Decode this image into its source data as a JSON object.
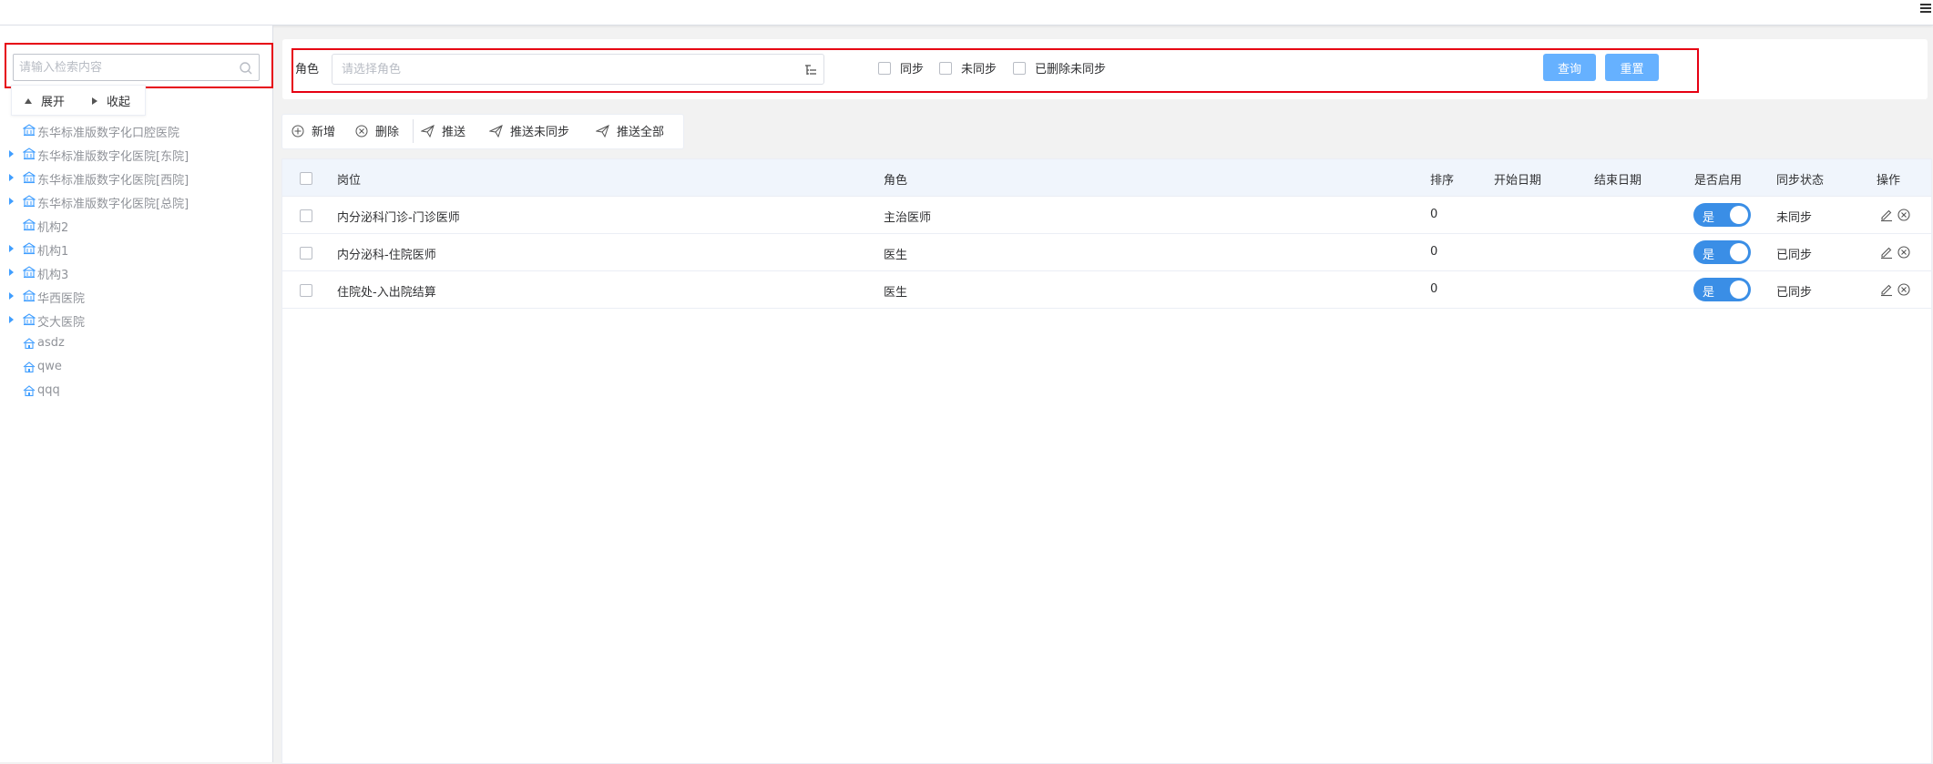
{
  "header": {
    "menu_icon": "hamburger-menu-icon"
  },
  "sidebar": {
    "search_placeholder": "请输入检索内容",
    "expand_label": "展开",
    "collapse_label": "收起",
    "tree": [
      {
        "label": "东华标准版数字化口腔医院",
        "has_children": false,
        "icon": "building-icon"
      },
      {
        "label": "东华标准版数字化医院[东院]",
        "has_children": true,
        "icon": "building-icon"
      },
      {
        "label": "东华标准版数字化医院[西院]",
        "has_children": true,
        "icon": "building-icon"
      },
      {
        "label": "东华标准版数字化医院[总院]",
        "has_children": true,
        "icon": "building-icon"
      },
      {
        "label": "机构2",
        "has_children": false,
        "icon": "building-icon"
      },
      {
        "label": "机构1",
        "has_children": true,
        "icon": "building-icon"
      },
      {
        "label": "机构3",
        "has_children": true,
        "icon": "building-icon"
      },
      {
        "label": "华西医院",
        "has_children": true,
        "icon": "building-icon"
      },
      {
        "label": "交大医院",
        "has_children": true,
        "icon": "building-icon"
      },
      {
        "label": "asdz",
        "has_children": false,
        "icon": "house-icon"
      },
      {
        "label": "qwe",
        "has_children": false,
        "icon": "house-icon"
      },
      {
        "label": "qqq",
        "has_children": false,
        "icon": "house-icon"
      }
    ]
  },
  "filter": {
    "role_label": "角色",
    "role_placeholder": "请选择角色",
    "checkboxes": [
      "同步",
      "未同步",
      "已删除未同步"
    ],
    "query_label": "查询",
    "reset_label": "重置"
  },
  "toolbar": {
    "add_label": "新增",
    "delete_label": "删除",
    "push_label": "推送",
    "push_unsynced_label": "推送未同步",
    "push_all_label": "推送全部"
  },
  "table": {
    "columns": {
      "post": "岗位",
      "role": "角色",
      "order": "排序",
      "start_date": "开始日期",
      "end_date": "结束日期",
      "enabled": "是否启用",
      "sync_status": "同步状态",
      "actions": "操作"
    },
    "rows": [
      {
        "post": "内分泌科门诊-门诊医师",
        "role": "主治医师",
        "order": "0",
        "start_date": "",
        "end_date": "",
        "enabled": "是",
        "sync_status": "未同步"
      },
      {
        "post": "内分泌科-住院医师",
        "role": "医生",
        "order": "0",
        "start_date": "",
        "end_date": "",
        "enabled": "是",
        "sync_status": "已同步"
      },
      {
        "post": "住院处-入出院结算",
        "role": "医生",
        "order": "0",
        "start_date": "",
        "end_date": "",
        "enabled": "是",
        "sync_status": "已同步"
      }
    ]
  },
  "colors": {
    "primary": "#409eff",
    "button": "#66b1ff",
    "switch_on": "#3a8ee6",
    "highlight_border": "#e60012",
    "table_header_bg": "#f0f5fc"
  }
}
